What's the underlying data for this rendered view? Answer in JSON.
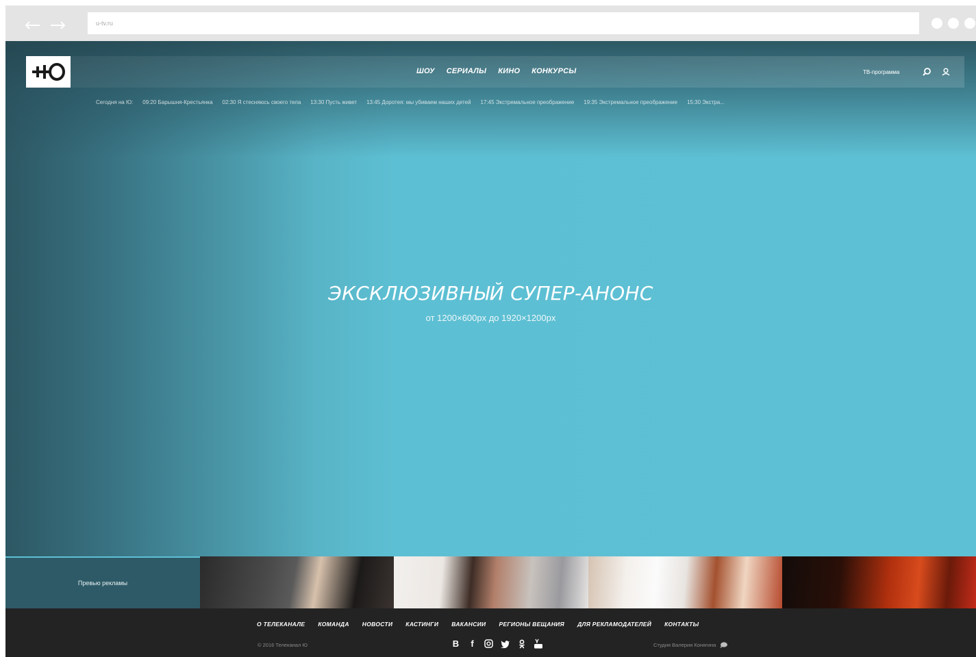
{
  "browser": {
    "address": "u-tv.ru",
    "back_icon": "arrow-left-icon",
    "forward_icon": "arrow-right-icon"
  },
  "header": {
    "logo_text": "+Ю",
    "nav": [
      {
        "label": "ШОУ"
      },
      {
        "label": "СЕРИАЛЫ"
      },
      {
        "label": "КИНО"
      },
      {
        "label": "КОНКУРСЫ"
      }
    ],
    "tv_program": "ТВ-программа",
    "search_icon": "search-icon",
    "user_icon": "user-icon"
  },
  "schedule": {
    "label": "Сегодня на Ю:",
    "items": [
      "09:20 Барышня-Крестьянка",
      "02:30 Я стесняюсь своего тела",
      "13:30 Пусть живет",
      "13:45 Доротея: мы убиваем наших детей",
      "17:45 Экстремальное преображение",
      "19:35 Экстремальное преображение",
      "15:30 Экстра..."
    ]
  },
  "hero": {
    "title": "ЭКСКЛЮЗИВНЫЙ СУПЕР-АНОНС",
    "subtitle": "от 1200×600px до 1920×1200px"
  },
  "promo": {
    "label": "Превью рекламы"
  },
  "footer": {
    "nav": [
      {
        "label": "О ТЕЛЕКАНАЛЕ"
      },
      {
        "label": "КОМАНДА"
      },
      {
        "label": "НОВОСТИ"
      },
      {
        "label": "КАСТИНГИ"
      },
      {
        "label": "ВАКАНСИИ"
      },
      {
        "label": "РЕГИОНЫ ВЕЩАНИЯ"
      },
      {
        "label": "ДЛЯ РЕКЛАМОДАТЕЛЕЙ"
      },
      {
        "label": "КОНТАКТЫ"
      }
    ],
    "copyright": "© 2016 Телеканал Ю",
    "studio": "Студия Валерия Конягина",
    "social": [
      {
        "icon": "vk-icon",
        "glyph": "В"
      },
      {
        "icon": "facebook-icon",
        "glyph": "f"
      },
      {
        "icon": "instagram-icon",
        "glyph": ""
      },
      {
        "icon": "twitter-icon",
        "glyph": ""
      },
      {
        "icon": "odnoklassniki-icon",
        "glyph": ""
      },
      {
        "icon": "youtube-icon",
        "glyph": ""
      }
    ]
  },
  "colors": {
    "hero_accent": "#5ec0d4",
    "hero_dark": "#2d5763",
    "footer_bg": "#232323"
  }
}
